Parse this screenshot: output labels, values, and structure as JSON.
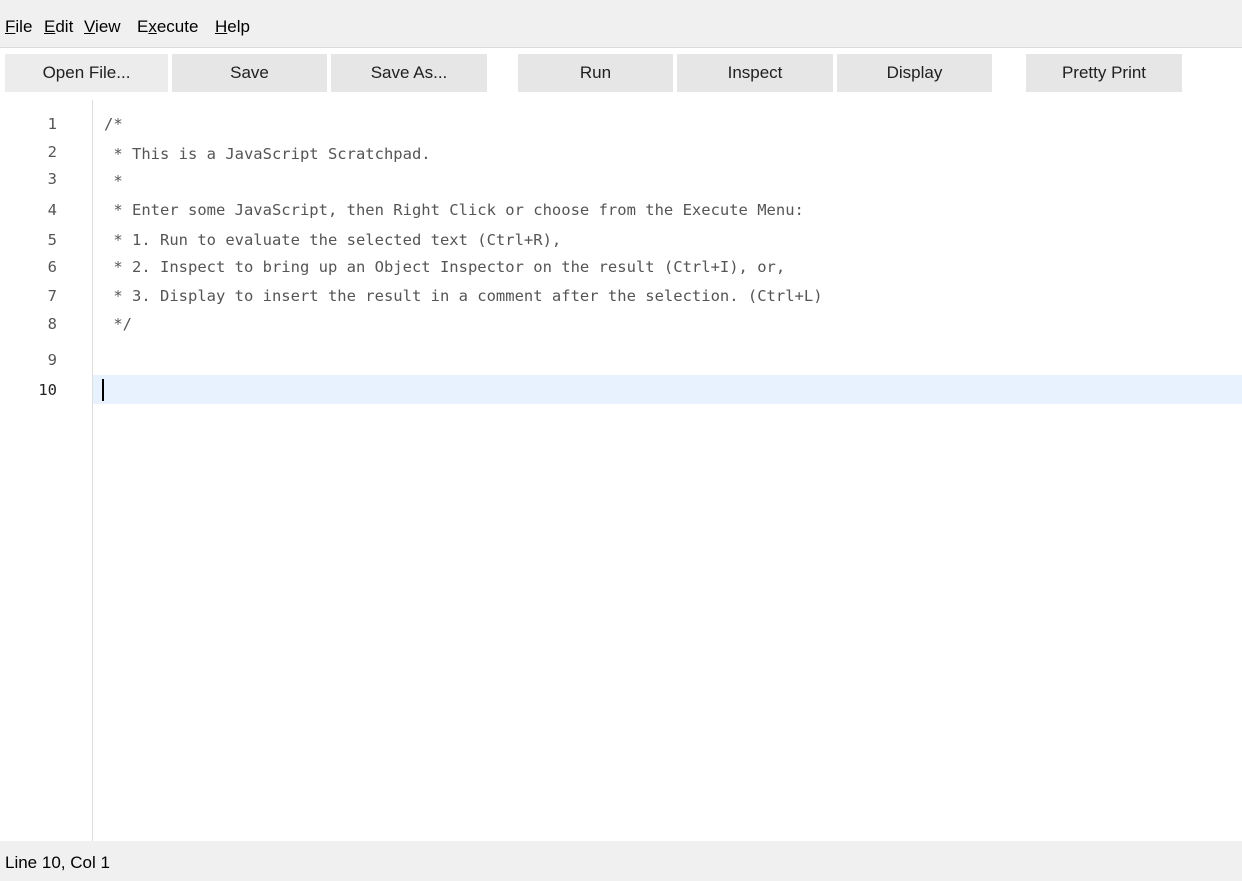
{
  "menubar": {
    "file_accel": "F",
    "file_rest": "ile",
    "edit_accel": "E",
    "edit_rest": "dit",
    "view_pre": "V",
    "view_accel": "i",
    "view_rest": "ew",
    "execute_pre": "E",
    "execute_accel": "x",
    "execute_rest": "ecute",
    "help_accel": "H",
    "help_rest": "elp"
  },
  "toolbar": {
    "open_file": "Open File...",
    "save": "Save",
    "save_as": "Save As...",
    "run": "Run",
    "inspect": "Inspect",
    "display": "Display",
    "pretty_print": "Pretty Print"
  },
  "editor": {
    "line_numbers": [
      "1",
      "2",
      "3",
      "4",
      "5",
      "6",
      "7",
      "8",
      "9",
      "10"
    ],
    "lines": [
      "/*",
      " * This is a JavaScript Scratchpad.",
      " *",
      " * Enter some JavaScript, then Right Click or choose from the Execute Menu:",
      " * 1. Run to evaluate the selected text (Ctrl+R),",
      " * 2. Inspect to bring up an Object Inspector on the result (Ctrl+I), or,",
      " * 3. Display to insert the result in a comment after the selection. (Ctrl+L)",
      " */",
      "",
      ""
    ]
  },
  "statusbar": {
    "position": "Line 10, Col 1"
  }
}
